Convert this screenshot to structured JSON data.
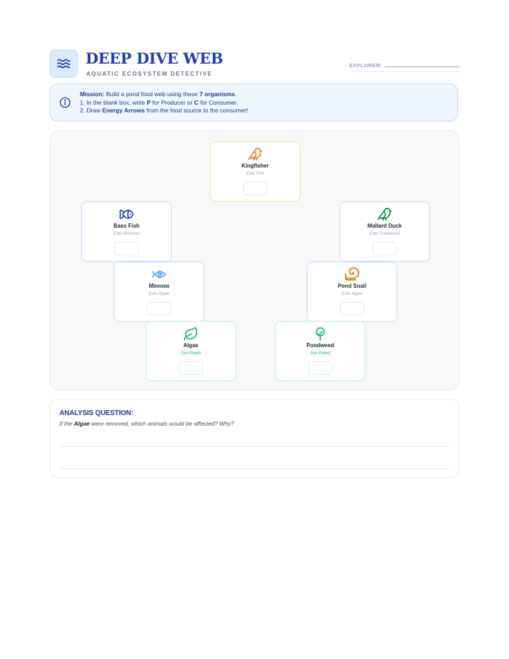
{
  "header": {
    "title": "DEEP DIVE WEB",
    "subtitle": "AQUATIC ECOSYSTEM DETECTIVE",
    "explorer_label": "EXPLORER:",
    "logo_icon": "waves-icon"
  },
  "mission": {
    "icon": "info-icon",
    "label": "Mission:",
    "intro": " Build a pond food web using these ",
    "count": "7 organisms",
    "intro_end": ".",
    "step1_a": "1. In the blank box, write ",
    "step1_p": "P",
    "step1_b": " for Producer or ",
    "step1_c": "C",
    "step1_d": " for Consumer.",
    "step2_a": "2. Draw ",
    "step2_b": "Energy Arrows",
    "step2_c": " from the food source to the consumer!"
  },
  "organisms": {
    "kingfisher": {
      "name": "Kingfisher",
      "diet": "Eats Fish",
      "icon": "bird-icon",
      "color": "#ea7a1c"
    },
    "bass_fish": {
      "name": "Bass Fish",
      "diet": "Eats Minnows",
      "icon": "fish-icon",
      "color": "#1e40af"
    },
    "mallard_duck": {
      "name": "Mallard Duck",
      "diet": "Eats Pondweed",
      "icon": "bird-icon",
      "color": "#15803d"
    },
    "minnow": {
      "name": "Minnow",
      "diet": "Eats Algae",
      "icon": "small-fish-icon",
      "color": "#60a5fa"
    },
    "pond_snail": {
      "name": "Pond Snail",
      "diet": "Eats Algae",
      "icon": "snail-icon",
      "color": "#d97706"
    },
    "algae": {
      "name": "Algae",
      "diet": "Sun Power",
      "icon": "leaf-icon",
      "color": "#10b981"
    },
    "pondweed": {
      "name": "Pondweed",
      "diet": "Sun Power",
      "icon": "plant-icon",
      "color": "#10b981"
    }
  },
  "analysis": {
    "heading": "ANALYSIS QUESTION:",
    "q_a": "If the ",
    "q_b": "Algae",
    "q_c": " were removed, which animals would be affected? Why?"
  },
  "colors": {
    "accent": "#1e40af",
    "producer": "#10b981",
    "apex": "#ea7a1c"
  }
}
